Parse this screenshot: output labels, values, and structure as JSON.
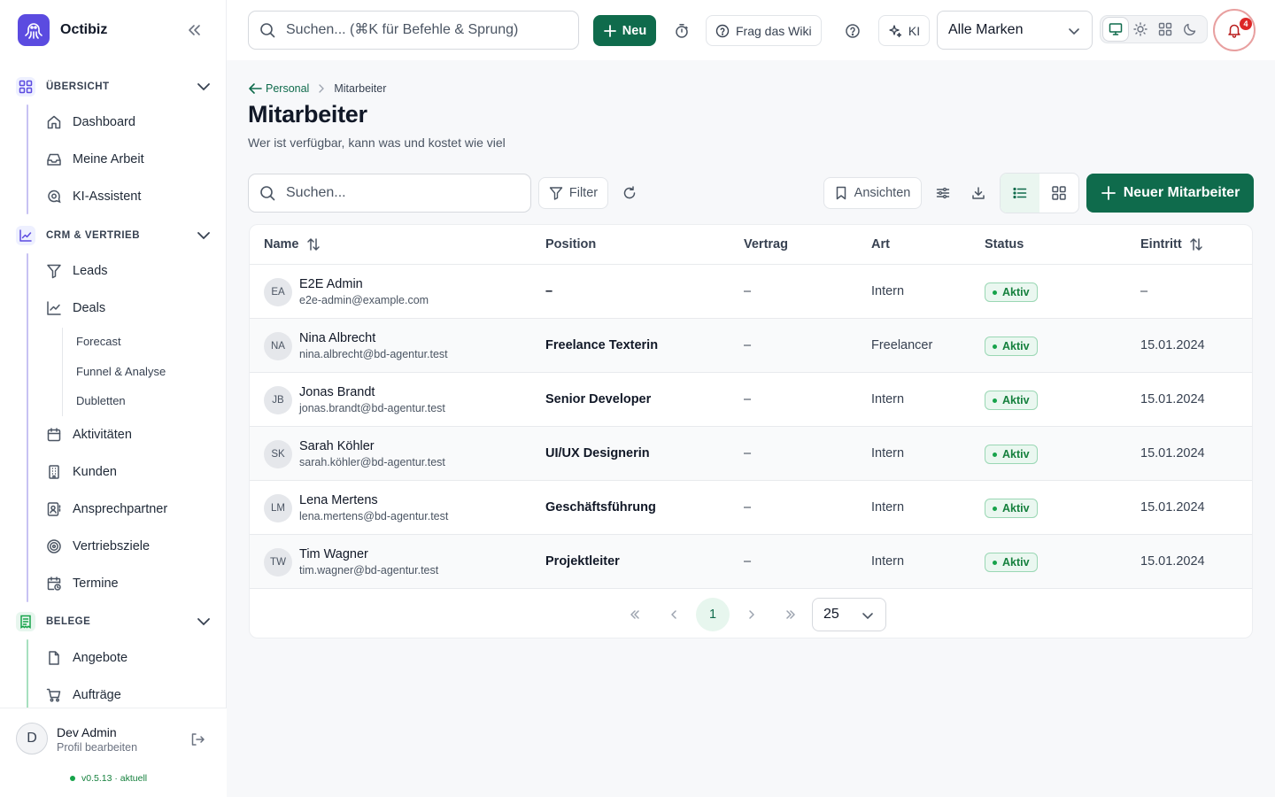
{
  "app": {
    "name": "Octibiz",
    "logo_icon": "octopus-icon",
    "accent": "#0f6b4c",
    "brand_color": "#5b4be0"
  },
  "sidebar": {
    "sections": [
      {
        "label": "ÜBERSICHT",
        "icon": "grid-icon",
        "items": [
          {
            "label": "Dashboard",
            "icon": "home-icon"
          },
          {
            "label": "Meine Arbeit",
            "icon": "inbox-icon"
          },
          {
            "label": "KI-Assistent",
            "icon": "chat-search-icon"
          }
        ]
      },
      {
        "label": "CRM & VERTRIEB",
        "icon": "chart-icon",
        "items": [
          {
            "label": "Leads",
            "icon": "funnel-icon"
          },
          {
            "label": "Deals",
            "icon": "trend-icon",
            "children": [
              "Forecast",
              "Funnel & Analyse",
              "Dubletten"
            ]
          },
          {
            "label": "Aktivitäten",
            "icon": "calendar-icon"
          },
          {
            "label": "Kunden",
            "icon": "building-icon"
          },
          {
            "label": "Ansprechpartner",
            "icon": "contact-icon"
          },
          {
            "label": "Vertriebsziele",
            "icon": "target-icon"
          },
          {
            "label": "Termine",
            "icon": "calendar-clock-icon"
          }
        ]
      },
      {
        "label": "BELEGE",
        "icon": "receipt-icon",
        "items": [
          {
            "label": "Angebote",
            "icon": "file-icon"
          },
          {
            "label": "Aufträge",
            "icon": "cart-icon"
          }
        ]
      }
    ],
    "user": {
      "initial": "D",
      "name": "Dev Admin",
      "sub": "Profil bearbeiten"
    },
    "version": "v0.5.13 · aktuell"
  },
  "topbar": {
    "search_placeholder": "Suchen... (⌘K für Befehle & Sprung)",
    "new_label": "Neu",
    "wiki_label": "Frag das Wiki",
    "ai_label": "KI",
    "brand_select": "Alle Marken",
    "notification_count": "4"
  },
  "page": {
    "breadcrumb_parent": "Personal",
    "breadcrumb_current": "Mitarbeiter",
    "title": "Mitarbeiter",
    "subtitle": "Wer ist verfügbar, kann was und kostet wie viel"
  },
  "toolbar": {
    "search_placeholder": "Suchen...",
    "filter_label": "Filter",
    "views_label": "Ansichten",
    "add_label": "Neuer Mitarbeiter"
  },
  "table": {
    "columns": {
      "name": "Name",
      "position": "Position",
      "contract": "Vertrag",
      "type": "Art",
      "status": "Status",
      "start": "Eintritt"
    },
    "rows": [
      {
        "initials": "EA",
        "name": "E2E Admin",
        "email": "e2e-admin@example.com",
        "position": "–",
        "contract": "–",
        "type": "Intern",
        "status": "Aktiv",
        "start": "–"
      },
      {
        "initials": "NA",
        "name": "Nina Albrecht",
        "email": "nina.albrecht@bd-agentur.test",
        "position": "Freelance Texterin",
        "contract": "–",
        "type": "Freelancer",
        "status": "Aktiv",
        "start": "15.01.2024"
      },
      {
        "initials": "JB",
        "name": "Jonas Brandt",
        "email": "jonas.brandt@bd-agentur.test",
        "position": "Senior Developer",
        "contract": "–",
        "type": "Intern",
        "status": "Aktiv",
        "start": "15.01.2024"
      },
      {
        "initials": "SK",
        "name": "Sarah Köhler",
        "email": "sarah.köhler@bd-agentur.test",
        "position": "UI/UX Designerin",
        "contract": "–",
        "type": "Intern",
        "status": "Aktiv",
        "start": "15.01.2024"
      },
      {
        "initials": "LM",
        "name": "Lena Mertens",
        "email": "lena.mertens@bd-agentur.test",
        "position": "Geschäftsführung",
        "contract": "–",
        "type": "Intern",
        "status": "Aktiv",
        "start": "15.01.2024"
      },
      {
        "initials": "TW",
        "name": "Tim Wagner",
        "email": "tim.wagner@bd-agentur.test",
        "position": "Projektleiter",
        "contract": "–",
        "type": "Intern",
        "status": "Aktiv",
        "start": "15.01.2024"
      }
    ]
  },
  "pagination": {
    "current_page": "1",
    "page_size": "25"
  }
}
